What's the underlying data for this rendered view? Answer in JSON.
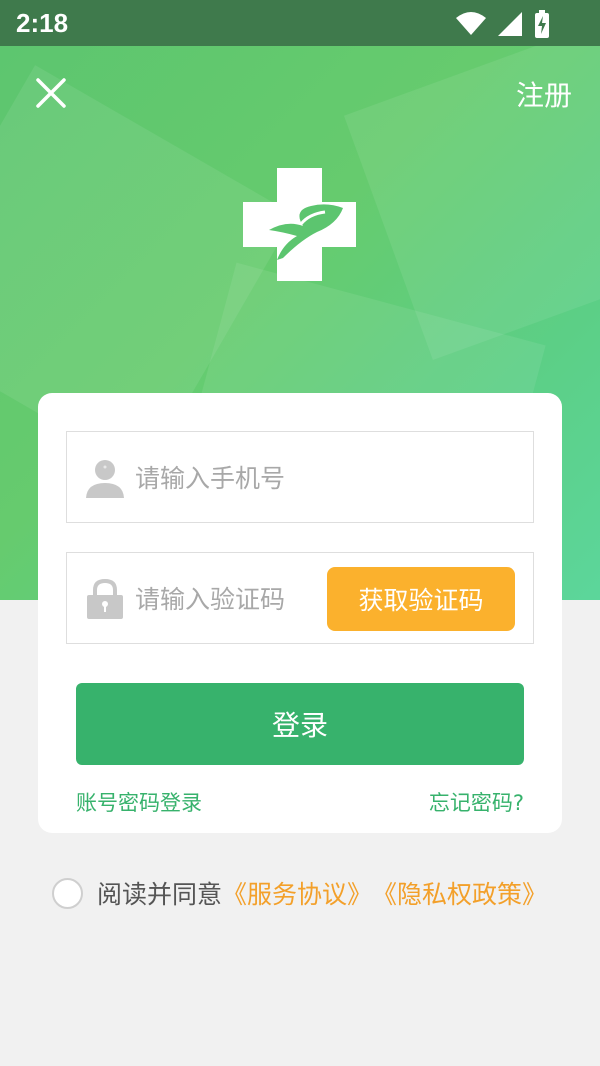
{
  "status_bar": {
    "time": "2:18"
  },
  "header": {
    "close_icon": "close-icon",
    "register_label": "注册"
  },
  "logo": {
    "icon": "medical-cross-hand-icon"
  },
  "form": {
    "phone": {
      "placeholder": "请输入手机号",
      "icon": "user-icon"
    },
    "code": {
      "placeholder": "请输入验证码",
      "icon": "lock-icon",
      "get_code_label": "获取验证码"
    },
    "login_label": "登录",
    "password_login_label": "账号密码登录",
    "forgot_label": "忘记密码?"
  },
  "agreement": {
    "prefix": "阅读并同意",
    "service": "《服务协议》",
    "privacy": "《隐私权政策》"
  },
  "colors": {
    "primary_green": "#37b26c",
    "orange": "#fbb12d",
    "link_orange": "#f3a02a",
    "hero_green": "#5cc56f"
  }
}
